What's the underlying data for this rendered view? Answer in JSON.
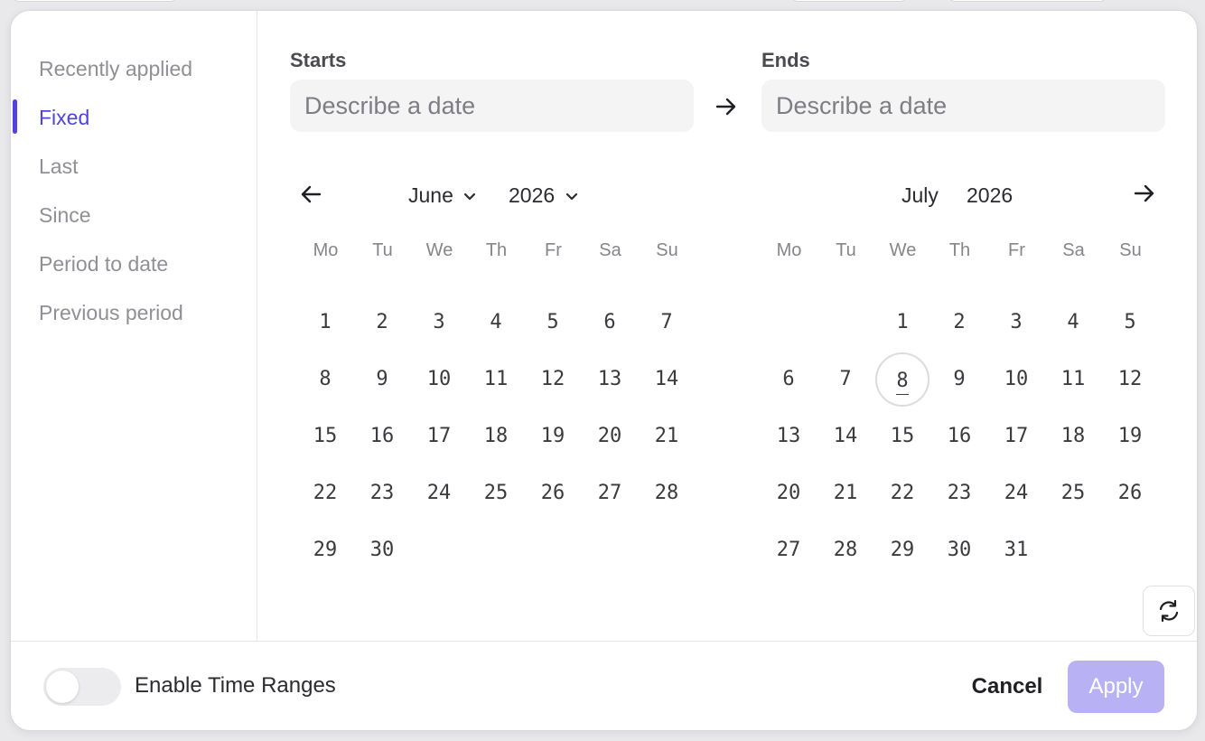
{
  "sidebar": {
    "items": [
      {
        "label": "Recently applied",
        "active": false
      },
      {
        "label": "Fixed",
        "active": true
      },
      {
        "label": "Last",
        "active": false
      },
      {
        "label": "Since",
        "active": false
      },
      {
        "label": "Period to date",
        "active": false
      },
      {
        "label": "Previous period",
        "active": false
      }
    ]
  },
  "range": {
    "starts_label": "Starts",
    "ends_label": "Ends",
    "starts_placeholder": "Describe a date",
    "ends_placeholder": "Describe a date"
  },
  "calendar_left": {
    "month": "June",
    "year": "2026",
    "days_in_month": 30,
    "first_weekday_index": 0
  },
  "calendar_right": {
    "month": "July",
    "year": "2026",
    "days_in_month": 31,
    "first_weekday_index": 2,
    "today": 8
  },
  "weekdays": [
    "Mo",
    "Tu",
    "We",
    "Th",
    "Fr",
    "Sa",
    "Su"
  ],
  "footer": {
    "toggle_label": "Enable Time Ranges",
    "toggle_on": false,
    "cancel_label": "Cancel",
    "apply_label": "Apply"
  },
  "colors": {
    "accent": "#4f44e0",
    "apply_disabled": "#b8b2f5"
  },
  "icons": {
    "prev": "arrow-left-icon",
    "next": "arrow-right-icon",
    "range": "arrow-right-icon",
    "dropdown": "chevron-down-icon",
    "refresh": "refresh-icon"
  }
}
